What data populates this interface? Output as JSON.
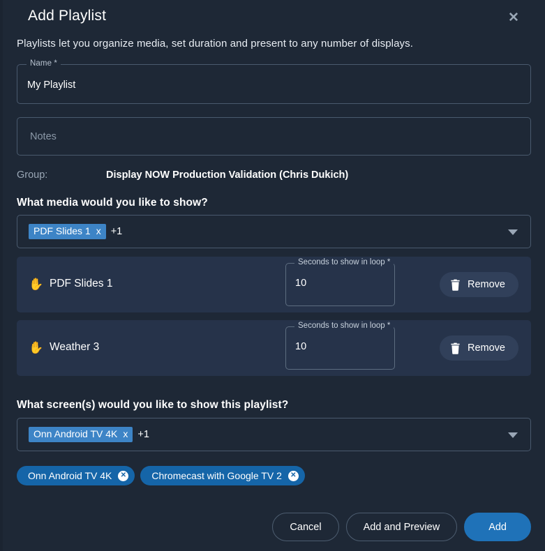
{
  "dialog": {
    "title": "Add Playlist",
    "subtitle": "Playlists let you organize media, set duration and present to any number of displays.",
    "close_icon": "close-icon"
  },
  "form": {
    "name": {
      "label": "Name *",
      "value": "My Playlist"
    },
    "notes": {
      "placeholder": "Notes",
      "value": ""
    },
    "group": {
      "label": "Group:",
      "value": "Display NOW Production Validation (Chris Dukich)"
    }
  },
  "media_section": {
    "question": "What media would you like to show?",
    "select": {
      "tag_label": "PDF Slides 1",
      "tag_remove": "x",
      "extra_count": "+1",
      "caret_icon": "chevron-down-icon"
    },
    "items": [
      {
        "drag_icon": "hand-drag-icon",
        "name": "PDF Slides 1",
        "seconds_label": "Seconds to show in loop *",
        "seconds_value": "10",
        "remove_label": "Remove",
        "remove_icon": "trash-icon"
      },
      {
        "drag_icon": "hand-drag-icon",
        "name": "Weather 3",
        "seconds_label": "Seconds to show in loop *",
        "seconds_value": "10",
        "remove_label": "Remove",
        "remove_icon": "trash-icon"
      }
    ]
  },
  "screen_section": {
    "question": "What screen(s) would you like to show this playlist?",
    "select": {
      "tag_label": "Onn Android TV 4K",
      "tag_remove": "x",
      "extra_count": "+1",
      "caret_icon": "chevron-down-icon"
    },
    "chips": [
      {
        "label": "Onn Android TV 4K",
        "remove_icon": "circle-close-icon"
      },
      {
        "label": "Chromecast with Google TV 2",
        "remove_icon": "circle-close-icon"
      }
    ]
  },
  "footer": {
    "cancel_label": "Cancel",
    "add_preview_label": "Add and Preview",
    "add_label": "Add"
  },
  "colors": {
    "dialog_bg": "#1e2836",
    "page_bg": "#1b2431",
    "card_bg": "#26334a",
    "accent_blue": "#1f72b8",
    "tag_blue": "#3d84c6",
    "chip_blue": "#1565a8",
    "border": "#4a5a6e",
    "muted_text": "#9aa7b6"
  }
}
